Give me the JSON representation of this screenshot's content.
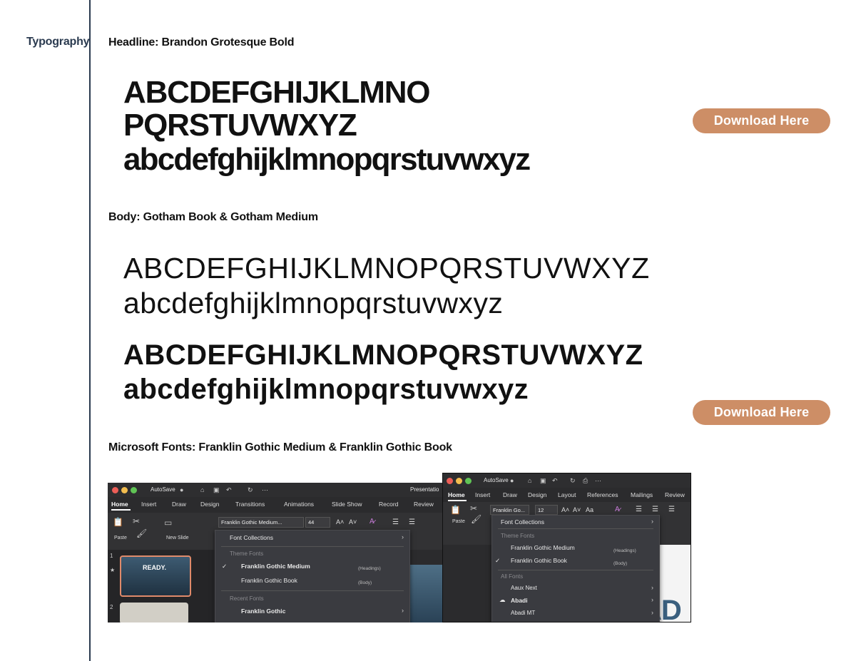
{
  "section_label": "Typography",
  "headline": {
    "heading": "Headline: Brandon Grotesque Bold",
    "line1": "ABCDEFGHIJKLMNO",
    "line2": "PQRSTUVWXYZ",
    "line3": "abcdefghijklmnopqrstuvwxyz",
    "download_label": "Download Here"
  },
  "body": {
    "heading": "Body: Gotham Book & Gotham Medium",
    "book_upper": "ABCDEFGHIJKLMNOPQRSTUVWXYZ",
    "book_lower": "abcdefghijklmnopqrstuvwxyz",
    "medium_upper": "ABCDEFGHIJKLMNOPQRSTUVWXYZ",
    "medium_lower": "abcdefghijklmnopqrstuvwxyz",
    "download_label": "Download Here"
  },
  "microsoft": {
    "heading": "Microsoft Fonts: Franklin Gothic Medium & Franklin Gothic Book",
    "shot_a": {
      "autosave": "AutoSave",
      "doc_title": "Presentatio",
      "menu": [
        "Home",
        "Insert",
        "Draw",
        "Design",
        "Transitions",
        "Animations",
        "Slide Show",
        "Record",
        "Review"
      ],
      "paste": "Paste",
      "new_slide": "New Slide",
      "font_name": "Franklin Gothic Medium...",
      "font_size": "44",
      "font_collections": "Font Collections",
      "theme_fonts": "Theme Fonts",
      "theme_font_1": "Franklin Gothic Medium",
      "theme_font_1_tag": "(Headings)",
      "theme_font_2": "Franklin Gothic Book",
      "theme_font_2_tag": "(Body)",
      "recent_fonts": "Recent Fonts",
      "recent_font_1": "Franklin Gothic",
      "slide_1": "1",
      "slide_2": "2",
      "thumb_text": "READY."
    },
    "shot_b": {
      "autosave": "AutoSave",
      "menu": [
        "Home",
        "Insert",
        "Draw",
        "Design",
        "Layout",
        "References",
        "Mailings",
        "Review"
      ],
      "paste": "Paste",
      "font_name": "Franklin Go...",
      "font_size": "12",
      "font_collections": "Font Collections",
      "theme_fonts": "Theme Fonts",
      "theme_font_1": "Franklin Gothic Medium",
      "theme_font_1_tag": "(Headings)",
      "theme_font_2": "Franklin Gothic Book",
      "theme_font_2_tag": "(Body)",
      "all_fonts": "All Fonts",
      "font_3": "Aaux Next",
      "font_4": "Abadi",
      "font_5": "Abadi MT",
      "canvas_text": "AD"
    }
  },
  "colors": {
    "accent_button": "#cd8e66",
    "rule_line": "#2a3a4f",
    "label": "#2a3a4f"
  }
}
